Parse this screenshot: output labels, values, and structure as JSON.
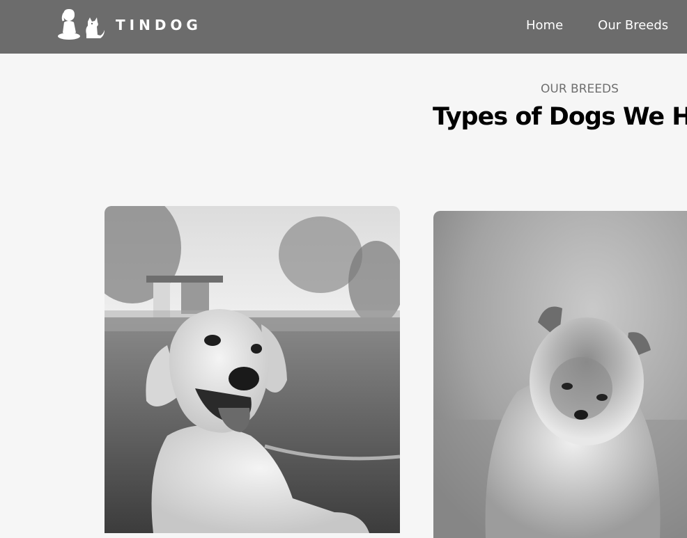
{
  "navbar": {
    "brand": "TINDOG",
    "logo_icon": "girl-and-dog-logo-icon",
    "links": [
      {
        "label": "Home"
      },
      {
        "label": "Our Breeds"
      }
    ]
  },
  "breeds_section": {
    "eyebrow": "OUR BREEDS",
    "title": "Types of Dogs We He",
    "cards": [
      {
        "image": "golden-retriever-photo"
      },
      {
        "image": "pomeranian-photo"
      }
    ]
  },
  "colors": {
    "navbar_bg": "#6c6c6c",
    "page_bg": "#f6f6f6",
    "eyebrow_text": "#6f6f6f",
    "title_text": "#000000"
  }
}
